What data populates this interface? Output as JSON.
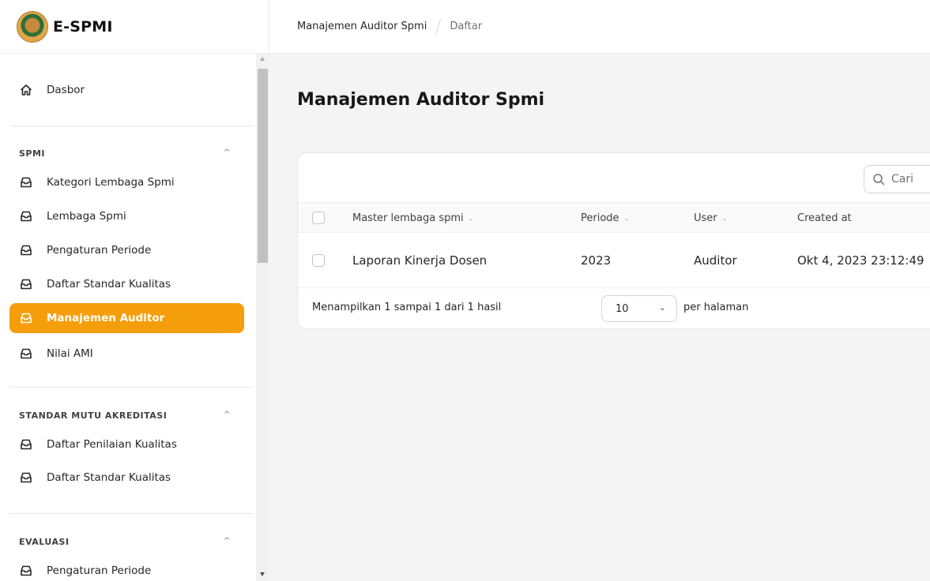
{
  "app": {
    "title": "E-SPMI"
  },
  "sidebar": {
    "dashboard": {
      "label": "Dasbor"
    },
    "groups": [
      {
        "title": "SPMI",
        "items": [
          {
            "label": "Kategori Lembaga Spmi"
          },
          {
            "label": "Lembaga Spmi"
          },
          {
            "label": "Pengaturan Periode"
          },
          {
            "label": "Daftar Standar Kualitas"
          },
          {
            "label": "Manajemen Auditor",
            "active": true
          },
          {
            "label": "Nilai AMI"
          }
        ]
      },
      {
        "title": "STANDAR MUTU AKREDITASI",
        "items": [
          {
            "label": "Daftar Penilaian Kualitas"
          },
          {
            "label": "Daftar Standar Kualitas"
          }
        ]
      },
      {
        "title": "EVALUASI",
        "items": [
          {
            "label": "Pengaturan Periode"
          }
        ]
      }
    ]
  },
  "breadcrumb": {
    "items": [
      "Manajemen Auditor Spmi",
      "Daftar"
    ]
  },
  "page": {
    "title": "Manajemen Auditor Spmi"
  },
  "table": {
    "search_placeholder": "Cari",
    "columns": [
      "Master lembaga spmi",
      "Periode",
      "User",
      "Created at"
    ],
    "rows": [
      {
        "master": "Laporan Kinerja Dosen",
        "periode": "2023",
        "user": "Auditor",
        "created_at": "Okt 4, 2023 23:12:49"
      }
    ],
    "footer": {
      "info": "Menampilkan 1 sampai 1 dari 1 hasil",
      "per_page_value": "10",
      "per_page_label": "per halaman"
    }
  },
  "colors": {
    "accent": "#f59e0b",
    "background": "#f4f4f5"
  }
}
